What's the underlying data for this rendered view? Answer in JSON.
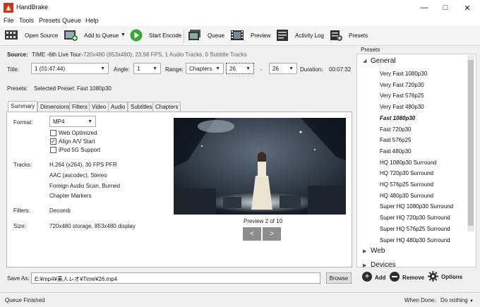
{
  "window": {
    "title": "HandBrake"
  },
  "menu": {
    "file": "File",
    "tools": "Tools",
    "presets": "Presets",
    "queue": "Queue",
    "help": "Help"
  },
  "toolbar": {
    "open_source": "Open Source",
    "add_to_queue": "Add to Queue",
    "start_encode": "Start Encode",
    "queue": "Queue",
    "preview": "Preview",
    "activity_log": "Activity Log",
    "presets": "Presets"
  },
  "source": {
    "label": "Source:",
    "name": "TIME -6th Live Tour-",
    "details": "720x480 (853x480), 23.98 FPS, 1 Audio Tracks, 0 Subtitle Tracks"
  },
  "title_row": {
    "title_label": "Title:",
    "title_value": "1 (01:47:44)",
    "angle_label": "Angle:",
    "angle_value": "1",
    "range_label": "Range:",
    "range_type": "Chapters",
    "range_start": "26",
    "range_dash": "-",
    "range_end": "26",
    "duration_label": "Duration:",
    "duration_value": "00:07:32"
  },
  "presets_row": {
    "label": "Presets:",
    "value": "Selected Preset: Fast 1080p30"
  },
  "tabs": [
    "Summary",
    "Dimensions",
    "Filters",
    "Video",
    "Audio",
    "Subtitles",
    "Chapters"
  ],
  "summary": {
    "format_label": "Format:",
    "format_value": "MP4",
    "web_optimized": "Web Optimized",
    "align_av": "Align A/V Start",
    "ipod": "iPod 5G Support",
    "tracks_label": "Tracks:",
    "tracks": [
      "H.264 (x264), 30 FPS PFR",
      "AAC (avcodec), Stereo",
      "Foreign Audio Scan, Burned",
      "Chapter Markers"
    ],
    "filters_label": "Filters:",
    "filters_value": "Decomb",
    "size_label": "Size:",
    "size_value": "720x480 storage, 853x480 display",
    "preview_caption": "Preview 2 of 10",
    "prev_btn": "<",
    "next_btn": ">"
  },
  "save_as": {
    "label": "Save As:",
    "path": "E:¥mp4¥素人レオ¥Time¥26.mp4",
    "browse": "Browse"
  },
  "presets_panel": {
    "header": "Presets",
    "general": "General",
    "items": [
      "Very Fast 1080p30",
      "Very Fast 720p30",
      "Very Fast 576p25",
      "Very Fast 480p30",
      "Fast 1080p30",
      "Fast 720p30",
      "Fast 576p25",
      "Fast 480p30",
      "HQ 1080p30 Surround",
      "HQ 720p30 Surround",
      "HQ 576p25 Surround",
      "HQ 480p30 Surround",
      "Super HQ 1080p30 Surround",
      "Super HQ 720p30 Surround",
      "Super HQ 576p25 Surround",
      "Super HQ 480p30 Surround"
    ],
    "selected": "Fast 1080p30",
    "web": "Web",
    "devices": "Devices",
    "add": "Add",
    "remove": "Remove",
    "options": "Options"
  },
  "status": {
    "left": "Queue Finished",
    "when_done_label": "When Done:",
    "when_done_value": "Do nothing"
  }
}
